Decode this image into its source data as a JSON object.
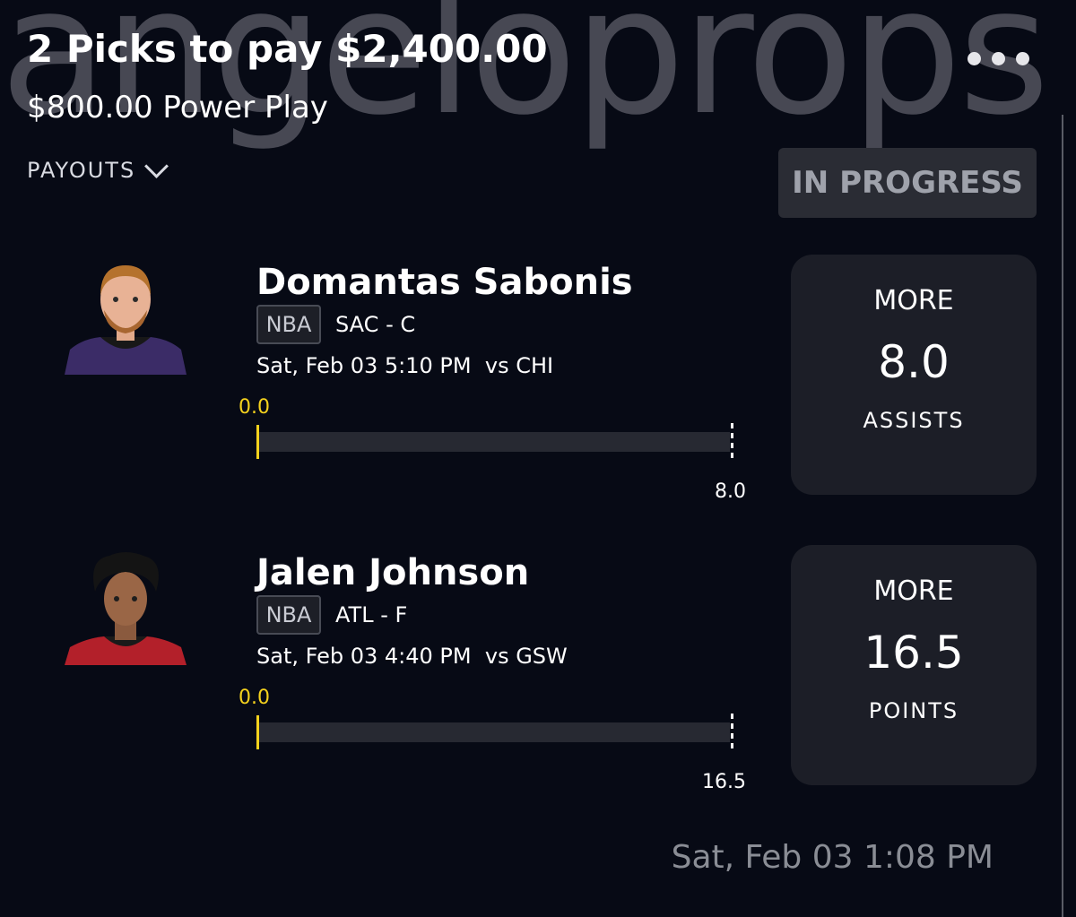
{
  "header": {
    "title": "2 Picks to pay $2,400.00",
    "subtitle": "$800.00 Power Play",
    "payouts_label": "PAYOUTS",
    "status": "IN PROGRESS",
    "watermark": "angeloprops"
  },
  "picks": [
    {
      "player": "Domantas Sabonis",
      "league": "NBA",
      "team_position": "SAC - C",
      "game": "Sat, Feb 03 5:10 PM  vs CHI",
      "current": "0.0",
      "target": "8.0",
      "progress": 0,
      "direction": "MORE",
      "line": "8.0",
      "stat": "ASSISTS",
      "jersey_color": "#3b2c67",
      "hair_color": "#b5722d"
    },
    {
      "player": "Jalen Johnson",
      "league": "NBA",
      "team_position": "ATL - F",
      "game": "Sat, Feb 03 4:40 PM  vs GSW",
      "current": "0.0",
      "target": "16.5",
      "progress": 0,
      "direction": "MORE",
      "line": "16.5",
      "stat": "POINTS",
      "jersey_color": "#b3202a",
      "hair_color": "#141414"
    }
  ],
  "footer": {
    "timestamp": "Sat, Feb 03 1:08 PM"
  },
  "colors": {
    "background": "#070a15",
    "accent_yellow": "#f5d21d",
    "card": "#1c1e27"
  },
  "icons": {
    "menu": "more-dots-icon",
    "payouts": "chevron-down-icon"
  }
}
